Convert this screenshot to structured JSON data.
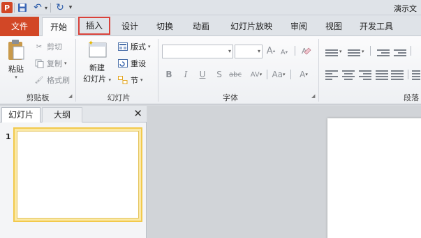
{
  "titlebar": {
    "app_icon": "P",
    "icons": [
      "powerpoint-app-icon",
      "save-icon",
      "undo-icon",
      "redo-icon",
      "customize-qat-icon"
    ],
    "window_title": "演示文"
  },
  "tabs": {
    "file": "文件",
    "home": "开始",
    "insert": "插入",
    "design": "设计",
    "transitions": "切换",
    "animations": "动画",
    "slideshow": "幻灯片放映",
    "review": "审阅",
    "view": "视图",
    "developer": "开发工具"
  },
  "ribbon": {
    "clipboard": {
      "paste": "粘贴",
      "cut": "剪切",
      "copy": "复制",
      "format_painter": "格式刷",
      "group_label": "剪贴板"
    },
    "slides": {
      "new_slide_line1": "新建",
      "new_slide_line2": "幻灯片",
      "layout": "版式",
      "reset": "重设",
      "section": "节",
      "group_label": "幻灯片"
    },
    "font": {
      "font_name_value": "",
      "font_size_value": "",
      "group_label": "字体",
      "bold": "B",
      "italic": "I",
      "underline": "U",
      "shadow": "S",
      "strikethrough": "abc",
      "char_spacing": "AV",
      "change_case": "Aa",
      "font_color": "A",
      "grow": "A",
      "shrink": "A"
    },
    "paragraph": {
      "group_label": "段落"
    }
  },
  "pane": {
    "tab_slides": "幻灯片",
    "tab_outline": "大纲",
    "close": "✕",
    "slide_number": "1"
  },
  "colors": {
    "file_tab": "#d24726",
    "highlight_box": "#d9413a",
    "thumb_border": "#f2c94c"
  }
}
